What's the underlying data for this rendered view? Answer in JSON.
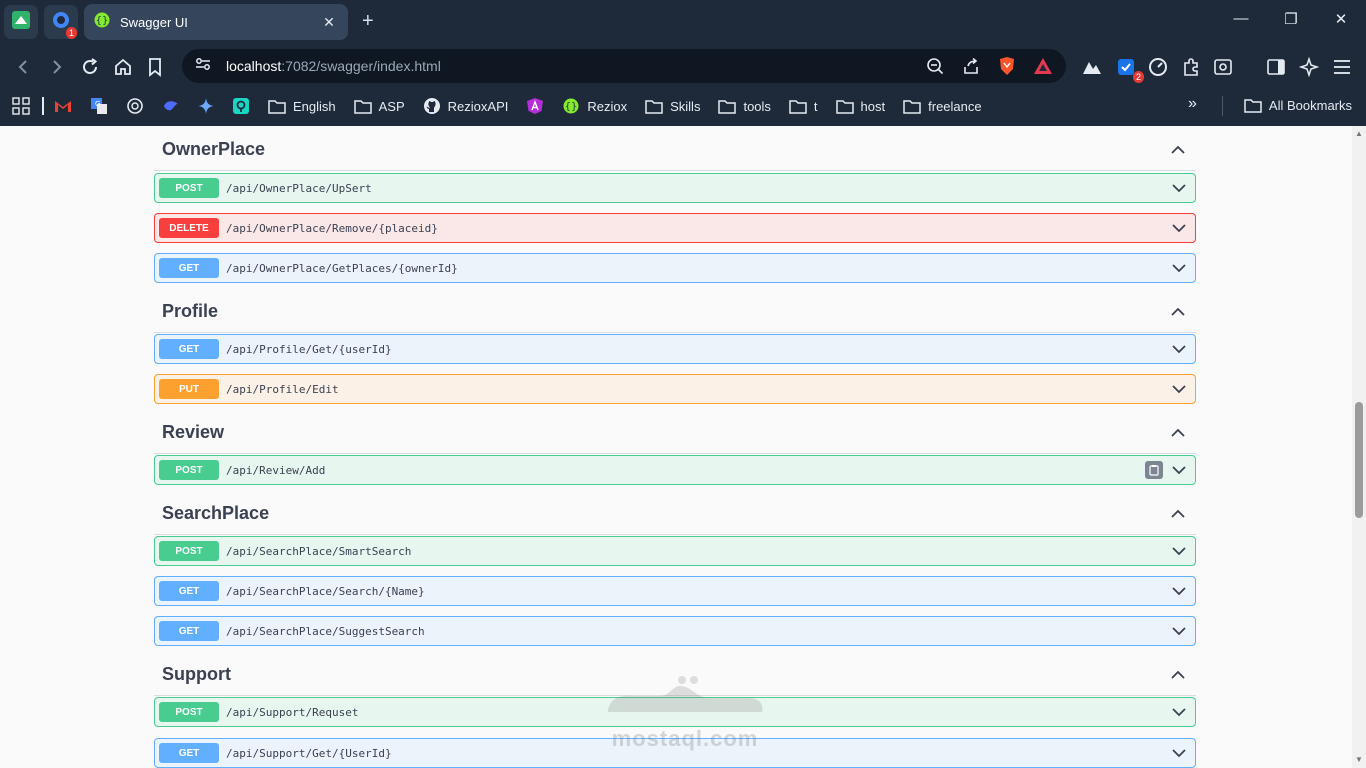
{
  "browser": {
    "tab_title": "Swagger UI",
    "url_host": "localhost",
    "url_rest": ":7082/swagger/index.html",
    "extension_badge": "2",
    "pinned_badge": "1"
  },
  "bookmarks": {
    "items": [
      {
        "label": "English",
        "icon": "folder-icon"
      },
      {
        "label": "ASP",
        "icon": "folder-icon"
      },
      {
        "label": "RezioxAPI",
        "icon": "github-icon"
      },
      {
        "label": "Reziox",
        "icon": "swagger-icon"
      },
      {
        "label": "Skills",
        "icon": "folder-icon"
      },
      {
        "label": "tools",
        "icon": "folder-icon"
      },
      {
        "label": "t",
        "icon": "folder-icon"
      },
      {
        "label": "host",
        "icon": "folder-icon"
      },
      {
        "label": "freelance",
        "icon": "folder-icon"
      }
    ],
    "all_bookmarks": "All Bookmarks"
  },
  "sections": [
    {
      "title": "OwnerPlace",
      "operations": [
        {
          "method": "POST",
          "path": "/api/OwnerPlace/UpSert"
        },
        {
          "method": "DELETE",
          "path": "/api/OwnerPlace/Remove/{placeid}"
        },
        {
          "method": "GET",
          "path": "/api/OwnerPlace/GetPlaces/{ownerId}"
        }
      ]
    },
    {
      "title": "Profile",
      "operations": [
        {
          "method": "GET",
          "path": "/api/Profile/Get/{userId}"
        },
        {
          "method": "PUT",
          "path": "/api/Profile/Edit"
        }
      ]
    },
    {
      "title": "Review",
      "operations": [
        {
          "method": "POST",
          "path": "/api/Review/Add"
        }
      ]
    },
    {
      "title": "SearchPlace",
      "operations": [
        {
          "method": "POST",
          "path": "/api/SearchPlace/SmartSearch"
        },
        {
          "method": "GET",
          "path": "/api/SearchPlace/Search/{Name}"
        },
        {
          "method": "GET",
          "path": "/api/SearchPlace/SuggestSearch"
        }
      ]
    },
    {
      "title": "Support",
      "operations": [
        {
          "method": "POST",
          "path": "/api/Support/Requset"
        },
        {
          "method": "GET",
          "path": "/api/Support/Get/{UserId}"
        }
      ]
    }
  ],
  "watermark": {
    "text": "mostaql.com"
  },
  "colors": {
    "post": "#49cc90",
    "get": "#61affe",
    "put": "#fca130",
    "delete": "#f93e3e",
    "chrome_bg": "#1e2a3a"
  }
}
